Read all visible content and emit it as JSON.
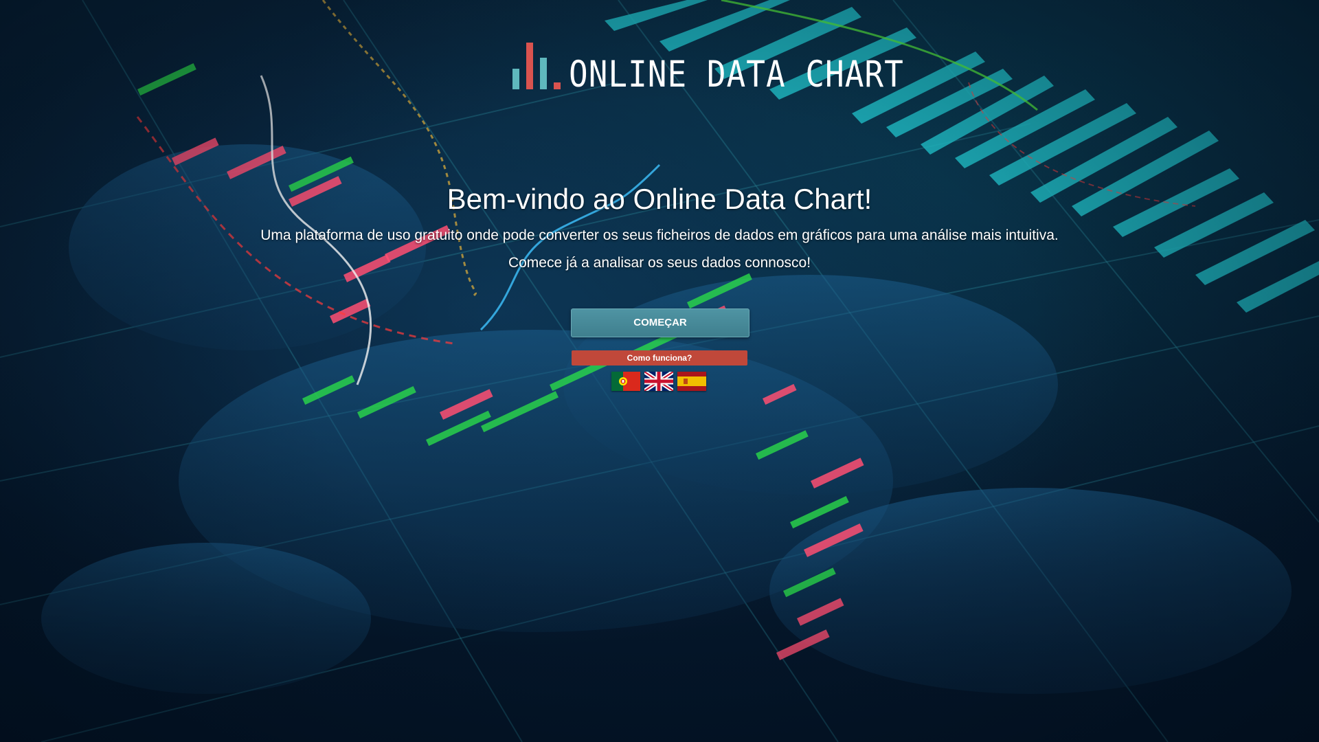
{
  "logo": {
    "text": "ONLINE DATA CHART",
    "icon": "bar-chart-logo-icon",
    "colors": {
      "teal": "#5fb8bd",
      "red": "#d9534f"
    }
  },
  "hero": {
    "title": "Bem-vindo ao Online Data Chart!",
    "subtitle": "Uma plataforma de uso gratuito onde pode converter os seus ficheiros de dados em gráficos para uma análise mais intuitiva.",
    "tagline": "Comece já a analisar os seus dados connosco!"
  },
  "actions": {
    "start_label": "COMEÇAR",
    "how_label": "Como funciona?"
  },
  "languages": [
    {
      "code": "pt",
      "icon": "portugal-flag-icon"
    },
    {
      "code": "en",
      "icon": "uk-flag-icon"
    },
    {
      "code": "es",
      "icon": "spain-flag-icon"
    }
  ],
  "theme": {
    "background": "#06182a",
    "start_button": "#4a8c9b",
    "how_button": "#c0483a"
  }
}
